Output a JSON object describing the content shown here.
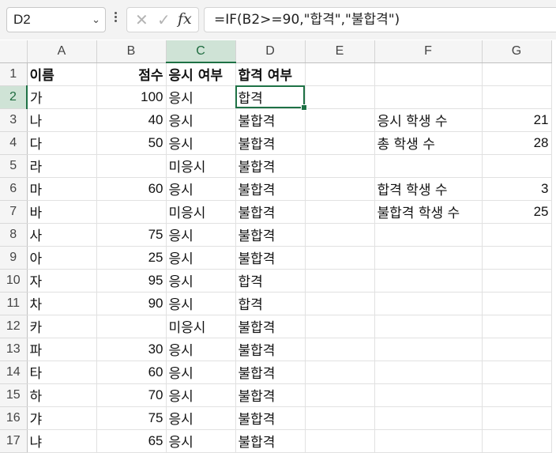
{
  "formula_bar": {
    "name_box": "D2",
    "formula": "=IF(B2>=90,\"합격\",\"불합격\")",
    "cancel_glyph": "✕",
    "enter_glyph": "✓",
    "fx_glyph": "fx"
  },
  "columns": [
    "A",
    "B",
    "C",
    "D",
    "E",
    "F",
    "G"
  ],
  "rows": [
    {
      "n": "1",
      "A": "이름",
      "B": "점수",
      "C": "응시 여부",
      "D": "합격 여부",
      "E": "",
      "F": "",
      "G": ""
    },
    {
      "n": "2",
      "A": "가",
      "B": "100",
      "C": "응시",
      "D": "합격",
      "E": "",
      "F": "",
      "G": ""
    },
    {
      "n": "3",
      "A": "나",
      "B": "40",
      "C": "응시",
      "D": "불합격",
      "E": "",
      "F": "응시 학생 수",
      "G": "21"
    },
    {
      "n": "4",
      "A": "다",
      "B": "50",
      "C": "응시",
      "D": "불합격",
      "E": "",
      "F": "총 학생 수",
      "G": "28"
    },
    {
      "n": "5",
      "A": "라",
      "B": "",
      "C": "미응시",
      "D": "불합격",
      "E": "",
      "F": "",
      "G": ""
    },
    {
      "n": "6",
      "A": "마",
      "B": "60",
      "C": "응시",
      "D": "불합격",
      "E": "",
      "F": "합격 학생 수",
      "G": "3"
    },
    {
      "n": "7",
      "A": "바",
      "B": "",
      "C": "미응시",
      "D": "불합격",
      "E": "",
      "F": "불합격 학생 수",
      "G": "25"
    },
    {
      "n": "8",
      "A": "사",
      "B": "75",
      "C": "응시",
      "D": "불합격",
      "E": "",
      "F": "",
      "G": ""
    },
    {
      "n": "9",
      "A": "아",
      "B": "25",
      "C": "응시",
      "D": "불합격",
      "E": "",
      "F": "",
      "G": ""
    },
    {
      "n": "10",
      "A": "자",
      "B": "95",
      "C": "응시",
      "D": "합격",
      "E": "",
      "F": "",
      "G": ""
    },
    {
      "n": "11",
      "A": "차",
      "B": "90",
      "C": "응시",
      "D": "합격",
      "E": "",
      "F": "",
      "G": ""
    },
    {
      "n": "12",
      "A": "카",
      "B": "",
      "C": "미응시",
      "D": "불합격",
      "E": "",
      "F": "",
      "G": ""
    },
    {
      "n": "13",
      "A": "파",
      "B": "30",
      "C": "응시",
      "D": "불합격",
      "E": "",
      "F": "",
      "G": ""
    },
    {
      "n": "14",
      "A": "타",
      "B": "60",
      "C": "응시",
      "D": "불합격",
      "E": "",
      "F": "",
      "G": ""
    },
    {
      "n": "15",
      "A": "하",
      "B": "70",
      "C": "응시",
      "D": "불합격",
      "E": "",
      "F": "",
      "G": ""
    },
    {
      "n": "16",
      "A": "갸",
      "B": "75",
      "C": "응시",
      "D": "불합격",
      "E": "",
      "F": "",
      "G": ""
    },
    {
      "n": "17",
      "A": "냐",
      "B": "65",
      "C": "응시",
      "D": "불합격",
      "E": "",
      "F": "",
      "G": ""
    }
  ],
  "selection": {
    "column": "D",
    "row": "2"
  },
  "colors": {
    "accent": "#1e7145",
    "header_selected_bg": "#cfe3d6"
  }
}
